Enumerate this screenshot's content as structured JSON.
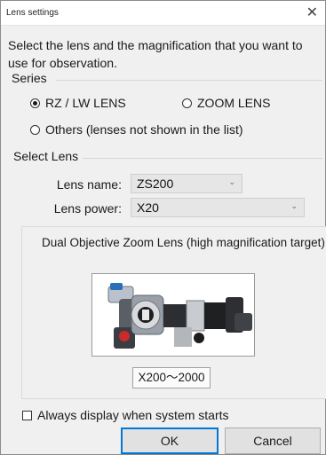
{
  "window": {
    "title": "Lens settings",
    "close_glyph": "✕"
  },
  "intro_text": "Select the lens and the magnification that you want to use for observation.",
  "series": {
    "caption": "Series",
    "options": [
      {
        "label": "RZ / LW LENS",
        "checked": true
      },
      {
        "label": "ZOOM LENS",
        "checked": false
      },
      {
        "label": "Others (lenses not shown in the list)",
        "checked": false
      }
    ]
  },
  "select_lens": {
    "caption": "Select Lens",
    "lens_name_label": "Lens name:",
    "lens_name_value": "ZS200",
    "lens_power_label": "Lens power:",
    "lens_power_value": "X20"
  },
  "lens_info": {
    "description": "Dual Objective Zoom Lens (high magnification target)",
    "magnification_range": "X200～2000"
  },
  "always_display": {
    "label": "Always display when system starts",
    "checked": false
  },
  "buttons": {
    "ok": "OK",
    "cancel": "Cancel"
  },
  "icons": {
    "close": "close-icon",
    "dropdown": "chevron-down-icon"
  }
}
